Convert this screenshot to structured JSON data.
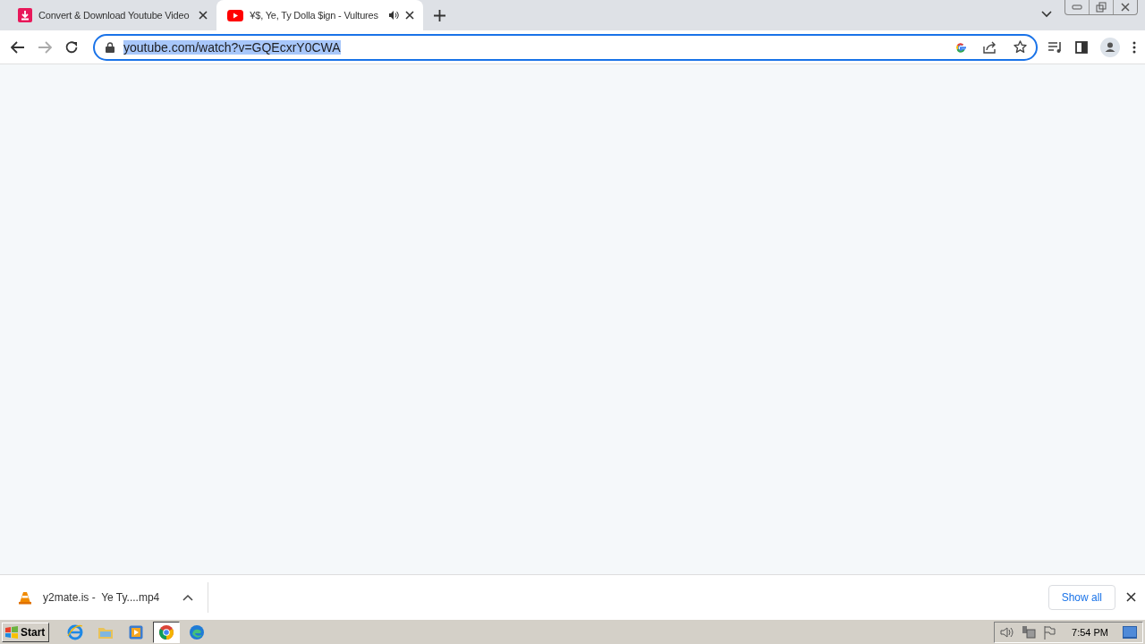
{
  "tabs": [
    {
      "title": "Convert & Download Youtube Video",
      "kind": "download-site",
      "selected": false,
      "audio": false
    },
    {
      "title": "¥$, Ye, Ty Dolla $ign - Vultures",
      "kind": "youtube",
      "selected": true,
      "audio": true
    }
  ],
  "address_bar": {
    "url": "youtube.com/watch?v=GQEcxrY0CWA",
    "text_selected": true
  },
  "download_bar": {
    "items": [
      {
        "name": "y2mate.is -  Ye Ty....mp4",
        "kind": "vlc"
      }
    ],
    "show_all": "Show all"
  },
  "taskbar": {
    "start": "Start",
    "apps": [
      {
        "kind": "ie",
        "selected": false
      },
      {
        "kind": "explorer",
        "selected": false
      },
      {
        "kind": "media",
        "selected": false
      },
      {
        "kind": "chrome",
        "selected": true
      },
      {
        "kind": "edge",
        "selected": false
      }
    ],
    "clock": "7:54 PM"
  }
}
